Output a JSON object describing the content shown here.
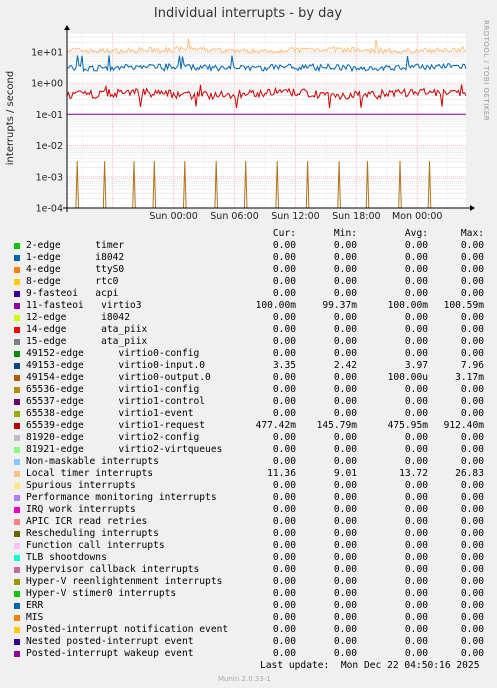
{
  "chart_data": {
    "type": "line",
    "title": "Individual interrupts - by day",
    "ylabel": "interrupts / second",
    "yscale": "log",
    "ylim": [
      0.0001,
      40
    ],
    "y_ticks": [
      {
        "value": 10,
        "label": "1e+01"
      },
      {
        "value": 1,
        "label": "1e+00"
      },
      {
        "value": 0.1,
        "label": "1e-01"
      },
      {
        "value": 0.01,
        "label": "1e-02"
      },
      {
        "value": 0.001,
        "label": "1e-03"
      },
      {
        "value": 0.0001,
        "label": "1e-04"
      }
    ],
    "x_ticks": [
      "Sun 00:00",
      "Sun 06:00",
      "Sun 12:00",
      "Sun 18:00",
      "Mon 00:00"
    ],
    "x_hours_range": [
      -10.5,
      28.8
    ],
    "side_label": "RRDTOOL / TOBI OETIKER",
    "series": [
      {
        "name": "Local timer interrupts",
        "color": "#FFC080",
        "level": 11.36,
        "min": 9.01,
        "max": 26.83,
        "style": "noisy"
      },
      {
        "name": "65539-edge virtio1-request",
        "color": "#0066B3",
        "level": 3.2,
        "min": 2.42,
        "max": 7.96,
        "style": "noisy"
      },
      {
        "name": "49153-edge virtio0-input.0",
        "color": "#CC0000",
        "level": 0.45,
        "min": 0.15,
        "max": 0.9,
        "style": "noisy"
      },
      {
        "name": "11-fasteoi virtio3",
        "color": "#7F00A0",
        "level": 0.1,
        "style": "flat"
      },
      {
        "name": "49154-edge virtio0-output.0",
        "color": "#B0731E",
        "style": "spikes",
        "spike_hours": [
          -9.5,
          -6.8,
          -3.9,
          -1.9,
          1.1,
          4.2,
          7.1,
          10.2,
          13.2,
          16.3,
          19.1,
          22.3,
          25.2
        ],
        "spike_value": 0.0032
      }
    ]
  },
  "legend": {
    "headers": {
      "cur": "Cur:",
      "min": "Min:",
      "avg": "Avg:",
      "max": "Max:"
    },
    "rows": [
      {
        "color": "#00CC00",
        "name": "2-edge      timer",
        "cur": "0.00",
        "min": "0.00",
        "avg": "0.00",
        "max": "0.00"
      },
      {
        "color": "#0066B3",
        "name": "1-edge      i8042",
        "cur": "0.00",
        "min": "0.00",
        "avg": "0.00",
        "max": "0.00"
      },
      {
        "color": "#FF8000",
        "name": "4-edge      ttyS0",
        "cur": "0.00",
        "min": "0.00",
        "avg": "0.00",
        "max": "0.00"
      },
      {
        "color": "#FFCC00",
        "name": "8-edge      rtc0",
        "cur": "0.00",
        "min": "0.00",
        "avg": "0.00",
        "max": "0.00"
      },
      {
        "color": "#330099",
        "name": "9-fasteoi   acpi",
        "cur": "0.00",
        "min": "0.00",
        "avg": "0.00",
        "max": "0.00"
      },
      {
        "color": "#990099",
        "name": "11-fasteoi   virtio3",
        "cur": "100.00m",
        "min": "99.37m",
        "avg": "100.00m",
        "max": "100.59m"
      },
      {
        "color": "#CCFF00",
        "name": "12-edge      i8042",
        "cur": "0.00",
        "min": "0.00",
        "avg": "0.00",
        "max": "0.00"
      },
      {
        "color": "#FF0000",
        "name": "14-edge      ata_piix",
        "cur": "0.00",
        "min": "0.00",
        "avg": "0.00",
        "max": "0.00"
      },
      {
        "color": "#808080",
        "name": "15-edge      ata_piix",
        "cur": "0.00",
        "min": "0.00",
        "avg": "0.00",
        "max": "0.00"
      },
      {
        "color": "#008F00",
        "name": "49152-edge      virtio0-config",
        "cur": "0.00",
        "min": "0.00",
        "avg": "0.00",
        "max": "0.00"
      },
      {
        "color": "#00487D",
        "name": "49153-edge      virtio0-input.0",
        "cur": "3.35",
        "min": "2.42",
        "avg": "3.97",
        "max": "7.96"
      },
      {
        "color": "#B35A00",
        "name": "49154-edge      virtio0-output.0",
        "cur": "0.00",
        "min": "0.00",
        "avg": "100.00u",
        "max": "3.17m"
      },
      {
        "color": "#B38F00",
        "name": "65536-edge      virtio1-config",
        "cur": "0.00",
        "min": "0.00",
        "avg": "0.00",
        "max": "0.00"
      },
      {
        "color": "#6B006B",
        "name": "65537-edge      virtio1-control",
        "cur": "0.00",
        "min": "0.00",
        "avg": "0.00",
        "max": "0.00"
      },
      {
        "color": "#8FB300",
        "name": "65538-edge      virtio1-event",
        "cur": "0.00",
        "min": "0.00",
        "avg": "0.00",
        "max": "0.00"
      },
      {
        "color": "#B30000",
        "name": "65539-edge      virtio1-request",
        "cur": "477.42m",
        "min": "145.79m",
        "avg": "475.95m",
        "max": "912.40m"
      },
      {
        "color": "#BEBEBE",
        "name": "81920-edge      virtio2-config",
        "cur": "0.00",
        "min": "0.00",
        "avg": "0.00",
        "max": "0.00"
      },
      {
        "color": "#80FF80",
        "name": "81921-edge      virtio2-virtqueues",
        "cur": "0.00",
        "min": "0.00",
        "avg": "0.00",
        "max": "0.00"
      },
      {
        "color": "#80C9FF",
        "name": "Non-maskable interrupts",
        "cur": "0.00",
        "min": "0.00",
        "avg": "0.00",
        "max": "0.00"
      },
      {
        "color": "#FFC080",
        "name": "Local timer interrupts",
        "cur": "11.36",
        "min": "9.01",
        "avg": "13.72",
        "max": "26.83"
      },
      {
        "color": "#FFE680",
        "name": "Spurious interrupts",
        "cur": "0.00",
        "min": "0.00",
        "avg": "0.00",
        "max": "0.00"
      },
      {
        "color": "#AA80FF",
        "name": "Performance monitoring interrupts",
        "cur": "0.00",
        "min": "0.00",
        "avg": "0.00",
        "max": "0.00"
      },
      {
        "color": "#EE00CC",
        "name": "IRQ work interrupts",
        "cur": "0.00",
        "min": "0.00",
        "avg": "0.00",
        "max": "0.00"
      },
      {
        "color": "#FF8080",
        "name": "APIC ICR read retries",
        "cur": "0.00",
        "min": "0.00",
        "avg": "0.00",
        "max": "0.00"
      },
      {
        "color": "#666600",
        "name": "Rescheduling interrupts",
        "cur": "0.00",
        "min": "0.00",
        "avg": "0.00",
        "max": "0.00"
      },
      {
        "color": "#FFBFFF",
        "name": "Function call interrupts",
        "cur": "0.00",
        "min": "0.00",
        "avg": "0.00",
        "max": "0.00"
      },
      {
        "color": "#00FFCC",
        "name": "TLB shootdowns",
        "cur": "0.00",
        "min": "0.00",
        "avg": "0.00",
        "max": "0.00"
      },
      {
        "color": "#CC6699",
        "name": "Hypervisor callback interrupts",
        "cur": "0.00",
        "min": "0.00",
        "avg": "0.00",
        "max": "0.00"
      },
      {
        "color": "#999900",
        "name": "Hyper-V reenlightenment interrupts",
        "cur": "0.00",
        "min": "0.00",
        "avg": "0.00",
        "max": "0.00"
      },
      {
        "color": "#00CC00",
        "name": "Hyper-V stimer0 interrupts",
        "cur": "0.00",
        "min": "0.00",
        "avg": "0.00",
        "max": "0.00"
      },
      {
        "color": "#0066B3",
        "name": "ERR",
        "cur": "0.00",
        "min": "0.00",
        "avg": "0.00",
        "max": "0.00"
      },
      {
        "color": "#FF8000",
        "name": "MIS",
        "cur": "0.00",
        "min": "0.00",
        "avg": "0.00",
        "max": "0.00"
      },
      {
        "color": "#FFCC00",
        "name": "Posted-interrupt notification event",
        "cur": "0.00",
        "min": "0.00",
        "avg": "0.00",
        "max": "0.00"
      },
      {
        "color": "#330099",
        "name": "Nested posted-interrupt event",
        "cur": "0.00",
        "min": "0.00",
        "avg": "0.00",
        "max": "0.00"
      },
      {
        "color": "#990099",
        "name": "Posted-interrupt wakeup event",
        "cur": "0.00",
        "min": "0.00",
        "avg": "0.00",
        "max": "0.00"
      }
    ]
  },
  "footer": {
    "last_update": "Last update:  Mon Dec 22 04:50:16 2025",
    "generator": "Munin 2.0.33-1"
  }
}
